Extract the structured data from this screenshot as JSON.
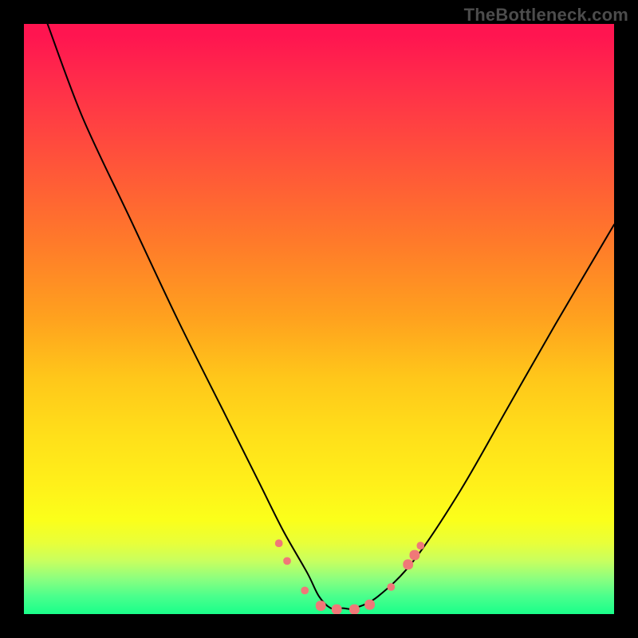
{
  "watermark": "TheBottleneck.com",
  "chart_data": {
    "type": "line",
    "title": "",
    "xlabel": "",
    "ylabel": "",
    "xlim": [
      0,
      100
    ],
    "ylim": [
      0,
      100
    ],
    "grid": false,
    "background": "vertical-gradient-red-to-green",
    "series": [
      {
        "name": "bottleneck-curve",
        "x": [
          4,
          10,
          18,
          26,
          34,
          40,
          44,
          48,
          50,
          52,
          54,
          56,
          60,
          66,
          74,
          82,
          90,
          100
        ],
        "y": [
          100,
          84,
          67,
          50,
          34,
          22,
          14,
          7,
          3,
          1,
          1,
          1,
          3,
          9,
          21,
          35,
          49,
          66
        ]
      }
    ],
    "markers": [
      {
        "x": 43.2,
        "y": 12.0,
        "size": 6
      },
      {
        "x": 44.6,
        "y": 9.0,
        "size": 6
      },
      {
        "x": 47.6,
        "y": 4.0,
        "size": 6
      },
      {
        "x": 50.3,
        "y": 1.4,
        "size": 8
      },
      {
        "x": 53.0,
        "y": 0.8,
        "size": 8
      },
      {
        "x": 56.0,
        "y": 0.8,
        "size": 8
      },
      {
        "x": 58.6,
        "y": 1.6,
        "size": 8
      },
      {
        "x": 62.2,
        "y": 4.6,
        "size": 6
      },
      {
        "x": 65.1,
        "y": 8.4,
        "size": 8
      },
      {
        "x": 66.2,
        "y": 10.0,
        "size": 8
      },
      {
        "x": 67.2,
        "y": 11.6,
        "size": 6
      }
    ]
  }
}
